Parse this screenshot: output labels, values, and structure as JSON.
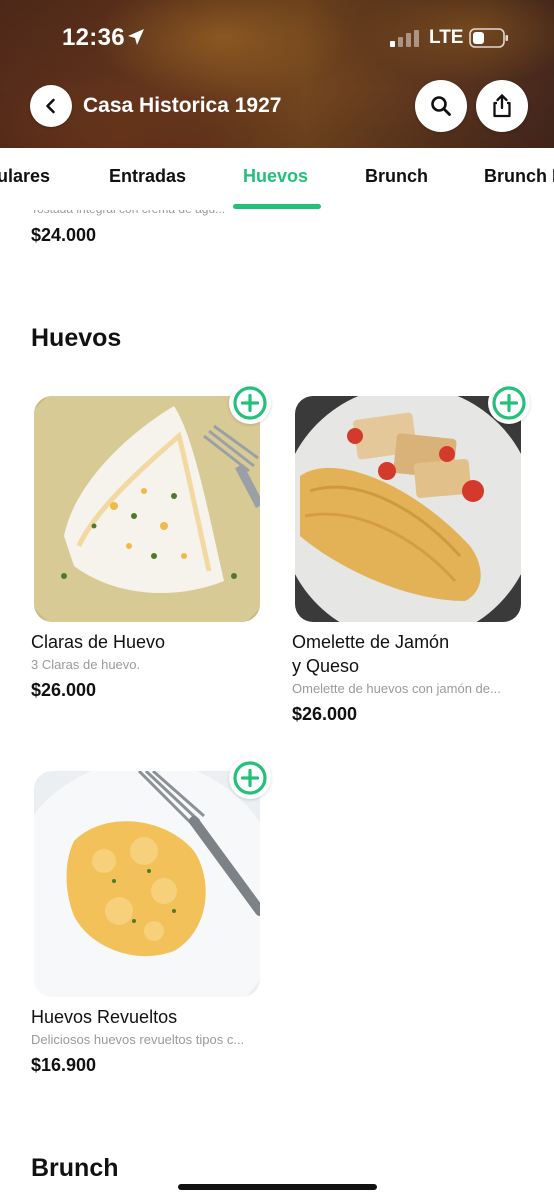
{
  "status_bar": {
    "time": "12:36",
    "network": "LTE"
  },
  "header": {
    "title": "Casa Historica 1927",
    "back_icon": "chevron-left-icon",
    "search_icon": "search-icon",
    "share_icon": "share-icon"
  },
  "tabs": {
    "items": [
      {
        "label": "ulares"
      },
      {
        "label": "Entradas"
      },
      {
        "label": "Huevos"
      },
      {
        "label": "Brunch"
      },
      {
        "label": "Brunch I"
      }
    ],
    "active": "Huevos",
    "active_color": "#22c17a"
  },
  "previous_item": {
    "description": "Tostada integral con crema de agu...",
    "price": "$24.000"
  },
  "sections": {
    "huevos": {
      "title": "Huevos",
      "items": [
        {
          "name": "Claras de Huevo",
          "description": "3 Claras de huevo.",
          "price": "$26.000"
        },
        {
          "name_line1": "Omelette de Jamón",
          "name_line2": "y Queso",
          "description": "Omelette de huevos con jamón de...",
          "price": "$26.000"
        },
        {
          "name": "Huevos Revueltos",
          "description": "Deliciosos huevos revueltos tipos c...",
          "price": "$16.900"
        }
      ]
    },
    "brunch": {
      "title": "Brunch"
    }
  },
  "accent_color": "#22c17a"
}
